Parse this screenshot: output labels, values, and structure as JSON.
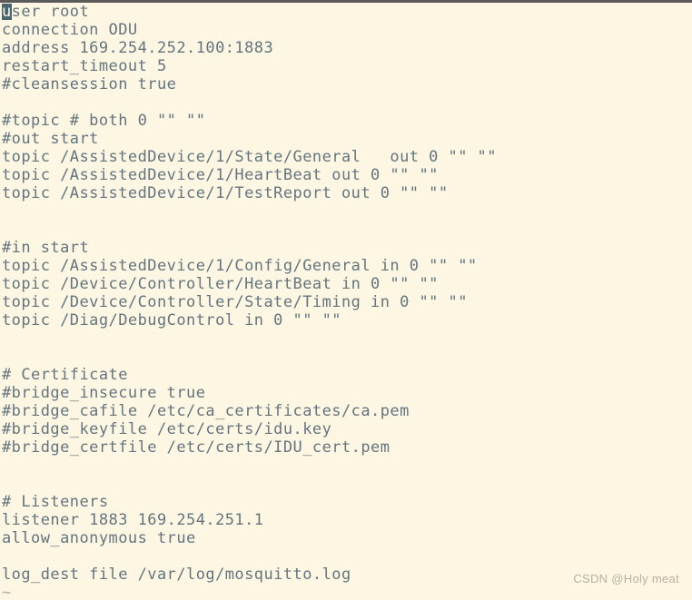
{
  "window": {
    "background_color": "#fdf6e3",
    "text_color": "#63757e",
    "cursor_color": "#4a6572",
    "tilde_color": "#b9ae93",
    "top_edge_color": "#5b5b5b"
  },
  "editor": {
    "cursor_char": "u",
    "tilde": "~",
    "lines": [
      "user root",
      "connection ODU",
      "address 169.254.252.100:1883",
      "restart_timeout 5",
      "#cleansession true",
      "",
      "#topic # both 0 \"\" \"\"",
      "#out start",
      "topic /AssistedDevice/1/State/General   out 0 \"\" \"\"",
      "topic /AssistedDevice/1/HeartBeat out 0 \"\" \"\"",
      "topic /AssistedDevice/1/TestReport out 0 \"\" \"\"",
      "",
      "",
      "#in start",
      "topic /AssistedDevice/1/Config/General in 0 \"\" \"\"",
      "topic /Device/Controller/HeartBeat in 0 \"\" \"\"",
      "topic /Device/Controller/State/Timing in 0 \"\" \"\"",
      "topic /Diag/DebugControl in 0 \"\" \"\"",
      "",
      "",
      "# Certificate",
      "#bridge_insecure true",
      "#bridge_cafile /etc/ca_certificates/ca.pem",
      "#bridge_keyfile /etc/certs/idu.key",
      "#bridge_certfile /etc/certs/IDU_cert.pem",
      "",
      "",
      "# Listeners",
      "listener 1883 169.254.251.1",
      "allow_anonymous true",
      "",
      "log_dest file /var/log/mosquitto.log"
    ]
  },
  "watermark": {
    "text": "CSDN @Holy meat"
  }
}
